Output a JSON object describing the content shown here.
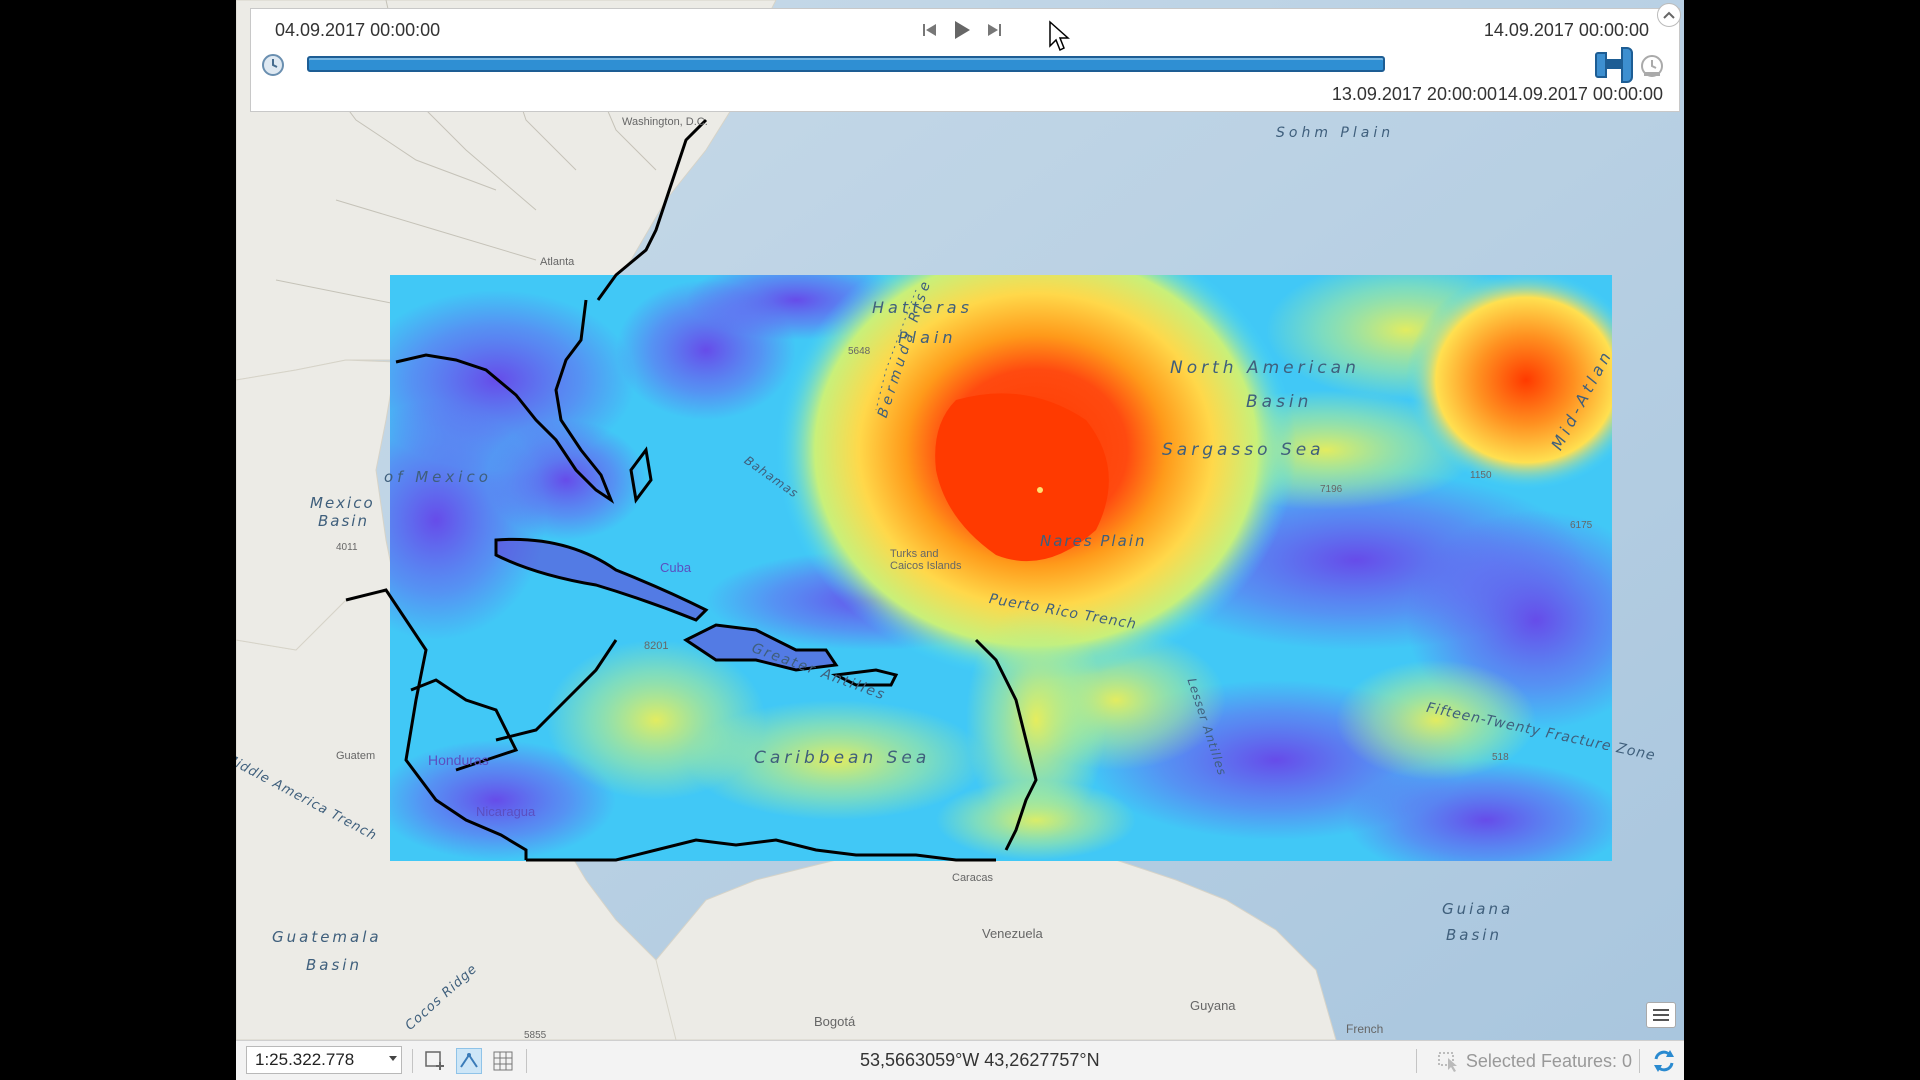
{
  "time_slider": {
    "start_time": "04.09.2017 00:00:00",
    "end_time": "14.09.2017 00:00:00",
    "current_start": "13.09.2017 20:00:00",
    "current_end": "14.09.2017 00:00:00",
    "position_fraction": 0.96
  },
  "map_labels": {
    "sohm_plain": "Sohm Plain",
    "hatteras": "Hatteras",
    "plain": "Plain",
    "bermuda_rise": "Bermuda Rise",
    "north_american": "North American",
    "basin": "Basin",
    "sargasso_sea": "Sargasso Sea",
    "nares_plain": "Nares Plain",
    "puerto_rico_trench": "Puerto Rico Trench",
    "caribbean_sea": "Caribbean Sea",
    "mexico_basin_1": "Mexico",
    "mexico_basin_2": "Basin",
    "guatemala_basin_1": "Guatemala",
    "guatemala_basin_2": "Basin",
    "guiana_basin_1": "Guiana",
    "guiana_basin_2": "Basin",
    "fifteen_twenty": "Fifteen-Twenty Fracture Zone",
    "mid_atlantic": "Mid-Atlan",
    "gulf_of_mexico": "of Mexico",
    "greater_antilles": "Greater Antilles",
    "lesser_antilles": "Lesser Antilles",
    "bahamas": "Bahamas",
    "middle_america_trench": "Middle America Trench",
    "cocos_ridge": "Cocos Ridge",
    "turks": "Turks and",
    "caicos": "Caicos Islands",
    "cuba": "Cuba",
    "honduras": "Honduras",
    "nicaragua": "Nicaragua",
    "venezuela": "Venezuela",
    "bogota": "Bogotá",
    "guyana": "Guyana",
    "atlanta": "Atlanta",
    "washington": "Washington, D.C.",
    "french": "French",
    "guatemala": "Guatem",
    "caracas": "Caracas"
  },
  "depth_labels": {
    "d1": "5648",
    "d2": "7196",
    "d3": "1150",
    "d4": "6175",
    "d5": "8201",
    "d6": "4011",
    "d7": "518",
    "d8": "5855"
  },
  "status_bar": {
    "scale": "1:25.322.778",
    "coordinates": "53,5663059°W 43,2627757°N",
    "selected_features": "Selected Features: 0"
  },
  "icons": {
    "clock": "clock-icon",
    "prev": "skip-back-icon",
    "play": "play-icon",
    "next": "skip-forward-icon",
    "live": "live-time-icon",
    "collapse": "chevron-up-icon",
    "refresh": "refresh-icon",
    "legend": "legend-icon",
    "select": "select-features-icon"
  },
  "colors": {
    "track": "#2f8fd3",
    "ocean": "#bcd3e6",
    "land": "#ecebe6"
  }
}
